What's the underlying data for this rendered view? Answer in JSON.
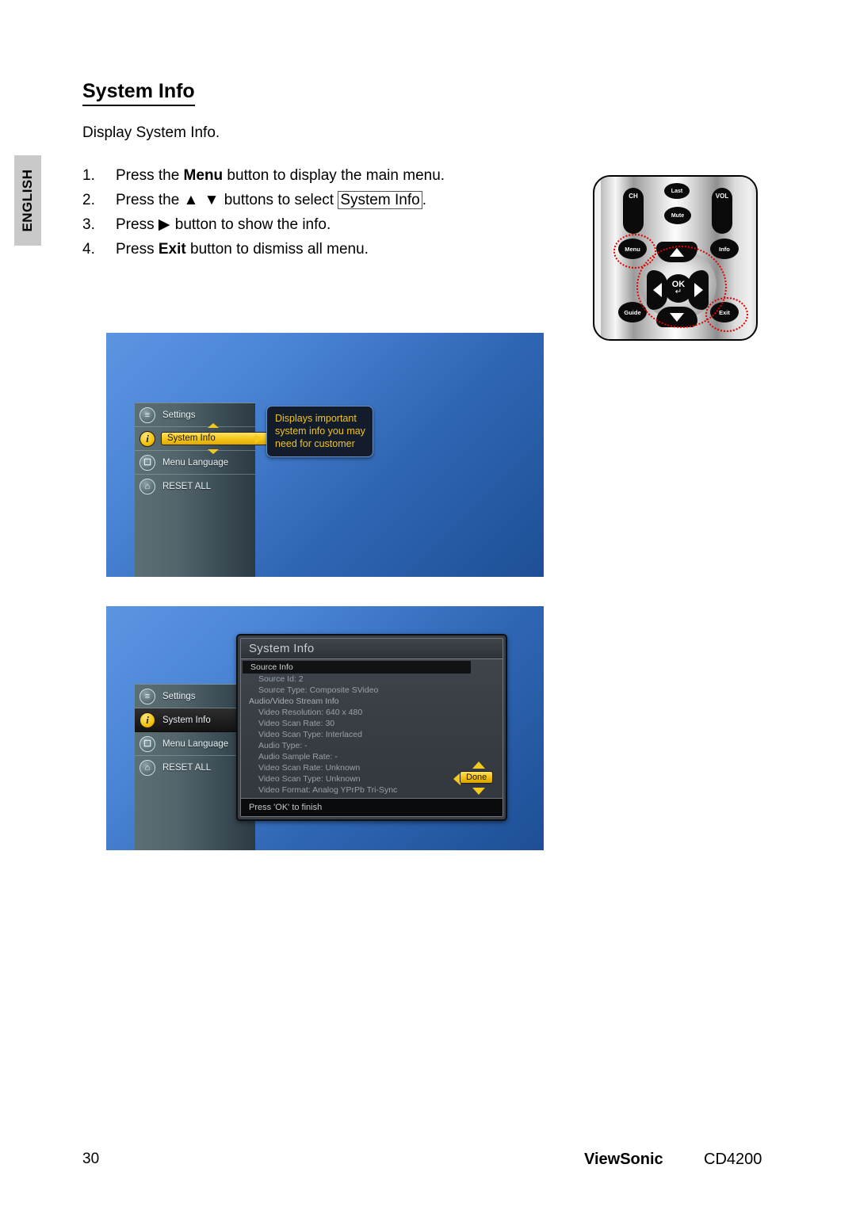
{
  "language_tab": "ENGLISH",
  "page": {
    "title": "System Info",
    "intro": "Display System Info.",
    "steps": [
      {
        "num": "1.",
        "pre": "Press the ",
        "bold": "Menu",
        "post": " button to display the main menu."
      },
      {
        "num": "2.",
        "pre": "Press the ",
        "arrows": "▲ ▼",
        "mid": " buttons to select ",
        "boxed": "System Info",
        "post": "."
      },
      {
        "num": "3.",
        "pre": "Press ",
        "arrows": "▶",
        "post": " button to show the info."
      },
      {
        "num": "4.",
        "pre": "Press ",
        "bold": "Exit",
        "post": " button to dismiss all menu."
      }
    ]
  },
  "remote": {
    "keys": {
      "ch": "CH",
      "vol": "VOL",
      "last": "Last",
      "mute": "Mute",
      "menu": "Menu",
      "info": "Info",
      "guide": "Guide",
      "exit": "Exit",
      "ok": "OK",
      "ok_return": "↵"
    },
    "highlight_color": "#e60000",
    "highlighted": [
      "Menu",
      "Exit",
      "navigation-pad"
    ]
  },
  "osd1": {
    "menu_items": [
      {
        "label": "Settings",
        "icon": "sliders-icon",
        "selected": false
      },
      {
        "label": "System Info",
        "icon": "info-circle-icon",
        "selected": true
      },
      {
        "label": "Menu Language",
        "icon": "language-icon",
        "selected": false
      },
      {
        "label": "RESET ALL",
        "icon": "home-icon",
        "selected": false
      }
    ],
    "tooltip_lines": [
      "Displays important",
      "system info you may",
      "need for customer"
    ],
    "tooltip_text_color": "#f2c41c",
    "highlight_color": "#f6c91d"
  },
  "osd2": {
    "menu_items": [
      {
        "label": "Settings",
        "icon": "sliders-icon",
        "selected": false
      },
      {
        "label": "System Info",
        "icon": "info-circle-icon",
        "selected": true
      },
      {
        "label": "Menu Language",
        "icon": "language-icon",
        "selected": false
      },
      {
        "label": "RESET ALL",
        "icon": "home-icon",
        "selected": false
      }
    ],
    "dialog": {
      "title": "System Info",
      "section_header": "Source Info",
      "rows": [
        {
          "text": "Source Id: 2",
          "level": "item"
        },
        {
          "text": "Source Type: Composite SVideo",
          "level": "item"
        },
        {
          "text": "Audio/Video Stream Info",
          "level": "sub"
        },
        {
          "text": "Video Resolution: 640 x 480",
          "level": "item"
        },
        {
          "text": "Video Scan Rate: 30",
          "level": "item"
        },
        {
          "text": "Video Scan Type: Interlaced",
          "level": "item"
        },
        {
          "text": "Audio Type: -",
          "level": "item"
        },
        {
          "text": "Audio Sample Rate: -",
          "level": "item"
        },
        {
          "text": "Video Scan Rate: Unknown",
          "level": "item"
        },
        {
          "text": "Video Scan Type: Unknown",
          "level": "item"
        },
        {
          "text": "Video Format: Analog YPrPb Tri-Sync",
          "level": "item"
        }
      ],
      "done_label": "Done",
      "footer": "Press 'OK' to finish"
    }
  },
  "footer": {
    "page_number": "30",
    "brand": "ViewSonic",
    "model": "CD4200"
  }
}
